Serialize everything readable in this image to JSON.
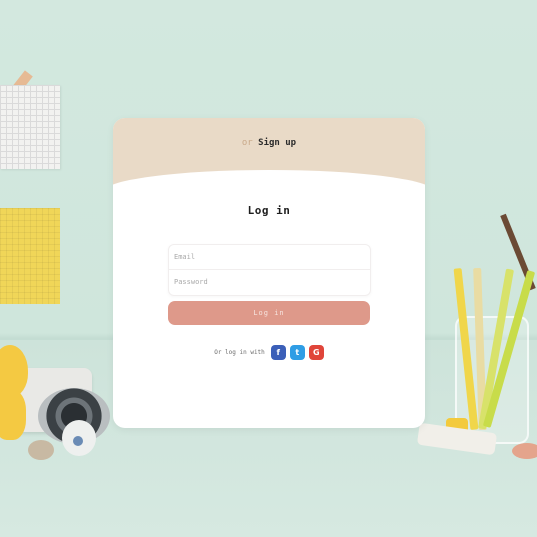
{
  "tabs": [
    {
      "label": "or",
      "active": false
    },
    {
      "label": "Sign up",
      "active": true
    }
  ],
  "heading": "Log in",
  "fields": {
    "email_placeholder": "Email",
    "password_placeholder": "Password"
  },
  "login_button": "Log in",
  "social": {
    "prompt": "Or log in with",
    "facebook": "f",
    "twitter": "t",
    "google": "G"
  },
  "colors": {
    "header": "#e9dac7",
    "primary_button": "#de998a",
    "facebook": "#3b5fb8",
    "twitter": "#2f9de5",
    "google": "#e0453a"
  },
  "icons": [
    "facebook-icon",
    "twitter-icon",
    "google-icon"
  ]
}
